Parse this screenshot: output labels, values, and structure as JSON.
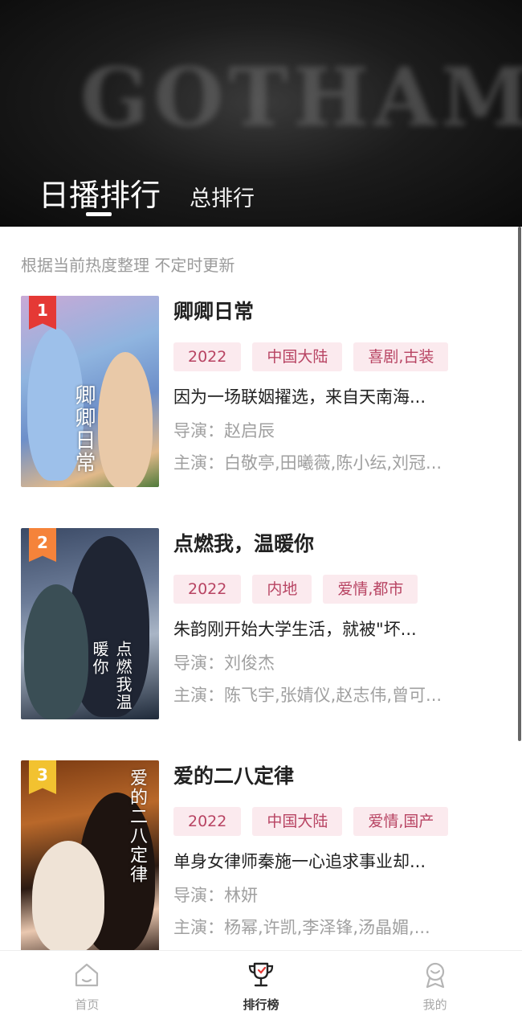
{
  "header": {
    "background_logo": "GOTHAM",
    "tabs": [
      {
        "label": "日播排行",
        "active": true
      },
      {
        "label": "总排行",
        "active": false
      }
    ]
  },
  "list": {
    "subtitle": "根据当前热度整理 不定时更新",
    "items": [
      {
        "rank": "1",
        "rank_color": "#e53935",
        "poster_text": "卿卿日常",
        "title": "卿卿日常",
        "tags": [
          "2022",
          "中国大陆",
          "喜剧,古装"
        ],
        "description": "因为一场联姻擢选，来自天南海...",
        "director": "导演：赵启辰",
        "cast": "主演：白敬亭,田曦薇,陈小纭,刘冠..."
      },
      {
        "rank": "2",
        "rank_color": "#f5833a",
        "poster_text": "点燃我温暖你",
        "title": "点燃我，温暖你",
        "tags": [
          "2022",
          "内地",
          "爱情,都市"
        ],
        "description": "朱韵刚开始大学生活，就被\"坏...",
        "director": "导演：刘俊杰",
        "cast": "主演：陈飞宇,张婧仪,赵志伟,曾可..."
      },
      {
        "rank": "3",
        "rank_color": "#f2c230",
        "poster_text": "爱的二八定律",
        "title": "爱的二八定律",
        "tags": [
          "2022",
          "中国大陆",
          "爱情,国产"
        ],
        "description": "单身女律师秦施一心追求事业却...",
        "director": "导演：林妍",
        "cast": "主演：杨幂,许凯,李泽锋,汤晶媚,..."
      }
    ]
  },
  "bottom_nav": {
    "items": [
      {
        "label": "首页",
        "icon": "home-icon",
        "active": false
      },
      {
        "label": "排行榜",
        "icon": "trophy-icon",
        "active": true
      },
      {
        "label": "我的",
        "icon": "profile-badge-icon",
        "active": false
      }
    ]
  },
  "colors": {
    "tag_background": "#fbeaee",
    "tag_text": "#b84463",
    "secondary_text": "#a0a0a0"
  }
}
